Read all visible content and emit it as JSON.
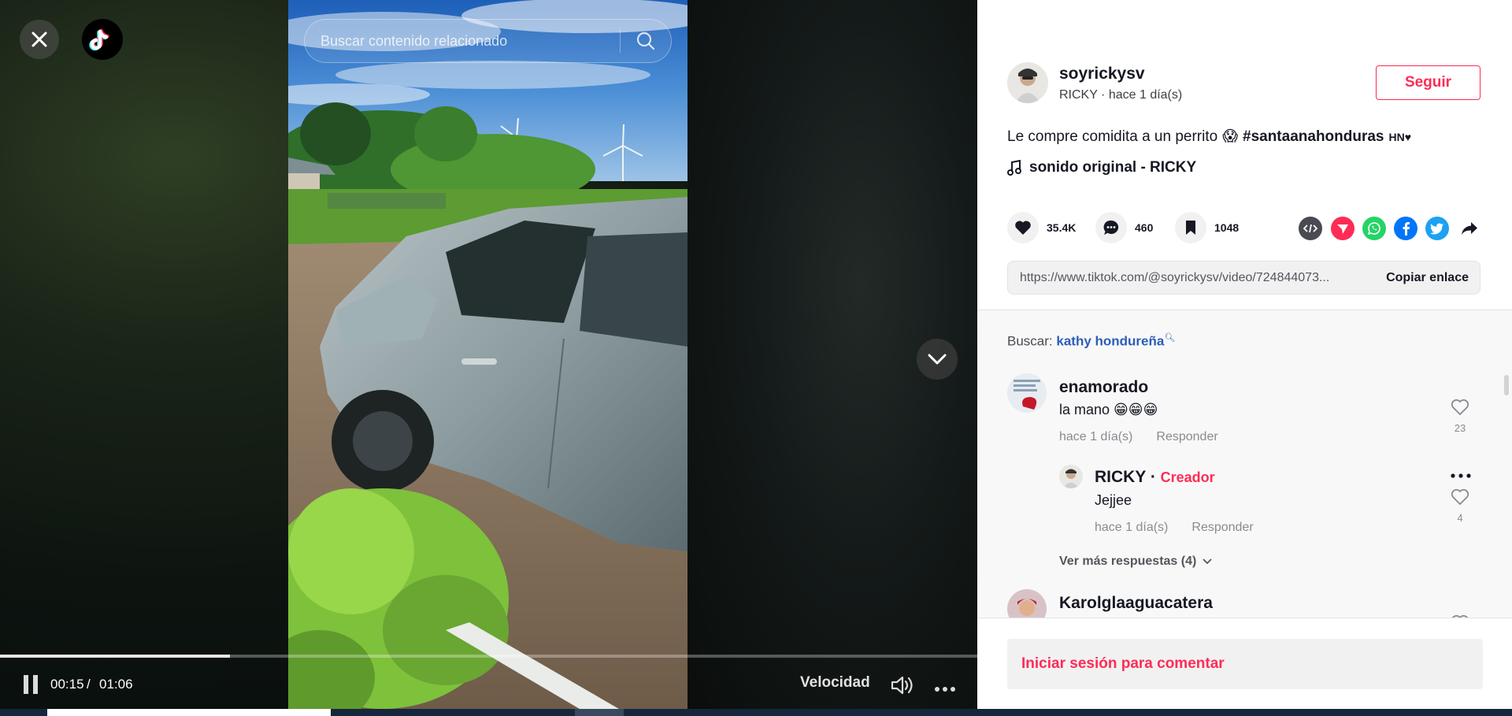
{
  "video": {
    "search": {
      "placeholder": "Buscar contenido relacionado"
    },
    "time_current": "00:15",
    "time_separator": "/",
    "time_total": "01:06",
    "progress_fraction": 0.235,
    "speed_label": "Velocidad",
    "icons": [
      "close-icon",
      "tiktok-logo-icon",
      "search-icon",
      "chevron-down-icon",
      "pause-icon",
      "volume-icon",
      "more-icon"
    ]
  },
  "author": {
    "username": "soyrickysv",
    "display_name": "RICKY",
    "separator": " · ",
    "time_ago": "hace 1 día(s)",
    "follow_label": "Seguir"
  },
  "post": {
    "description": "Le compre comidita a un perrito",
    "emoji": "😱",
    "hashtag": "#santaanahonduras",
    "suffix": "HN♥",
    "sound": "sonido original - RICKY"
  },
  "stats": {
    "likes": "35.4K",
    "comments": "460",
    "saves": "1048"
  },
  "share": {
    "icons": [
      "embed-icon",
      "send-icon",
      "whatsapp-icon",
      "facebook-icon",
      "twitter-icon",
      "share-forward-icon"
    ]
  },
  "link": {
    "url": "https://www.tiktok.com/@soyrickysv/video/724844073...",
    "copy_label": "Copiar enlace"
  },
  "search_suggestion": {
    "prefix": "Buscar:",
    "term": "kathy hondureña"
  },
  "comments": [
    {
      "user": "enamorado",
      "text": "la mano 😁😁😁",
      "time": "hace 1 día(s)",
      "reply_label": "Responder",
      "likes": "23",
      "replies": [
        {
          "user": "RICKY",
          "badge_separator": "·",
          "badge": "Creador",
          "text": "Jejjee",
          "time": "hace 1 día(s)",
          "reply_label": "Responder",
          "likes": "4"
        }
      ],
      "more_replies_label": "Ver más respuestas (4)"
    },
    {
      "user": "Karolglaaguacatera"
    }
  ],
  "login_comment_label": "Iniciar sesión para comentar",
  "colors": {
    "accent": "#fe2c55",
    "link": "#2b5db9",
    "text": "#161823",
    "muted": "#8a8b91"
  }
}
